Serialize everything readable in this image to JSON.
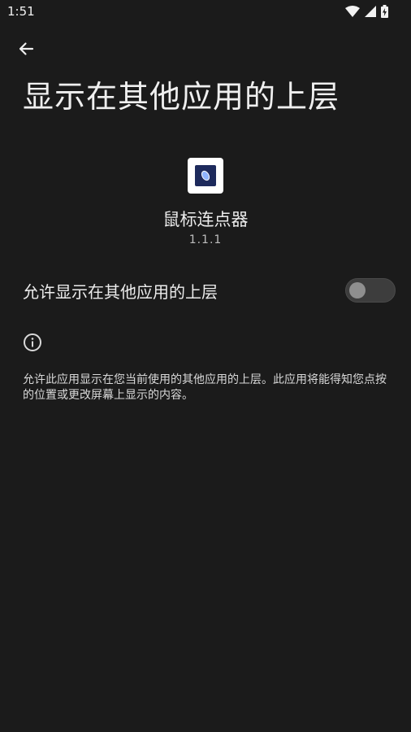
{
  "status_bar": {
    "time": "1:51",
    "icons": [
      "wifi-icon",
      "cell-signal-icon",
      "battery-charging-icon"
    ]
  },
  "header": {
    "back_icon": "arrow-back-icon",
    "title": "显示在其他应用的上层"
  },
  "app": {
    "icon": "mouse-clicker-app-icon",
    "name": "鼠标连点器",
    "version": "1.1.1"
  },
  "permission": {
    "label": "允许显示在其他应用的上层",
    "enabled": false
  },
  "info": {
    "icon": "info-icon",
    "description": "允许此应用显示在您当前使用的其他应用的上层。此应用将能得知您点按的位置或更改屏幕上显示的内容。"
  },
  "colors": {
    "background": "#1b1b1b",
    "text_primary": "#ececec",
    "toggle_track_off": "#3d3d3d",
    "toggle_thumb_off": "#8f8f8f"
  }
}
